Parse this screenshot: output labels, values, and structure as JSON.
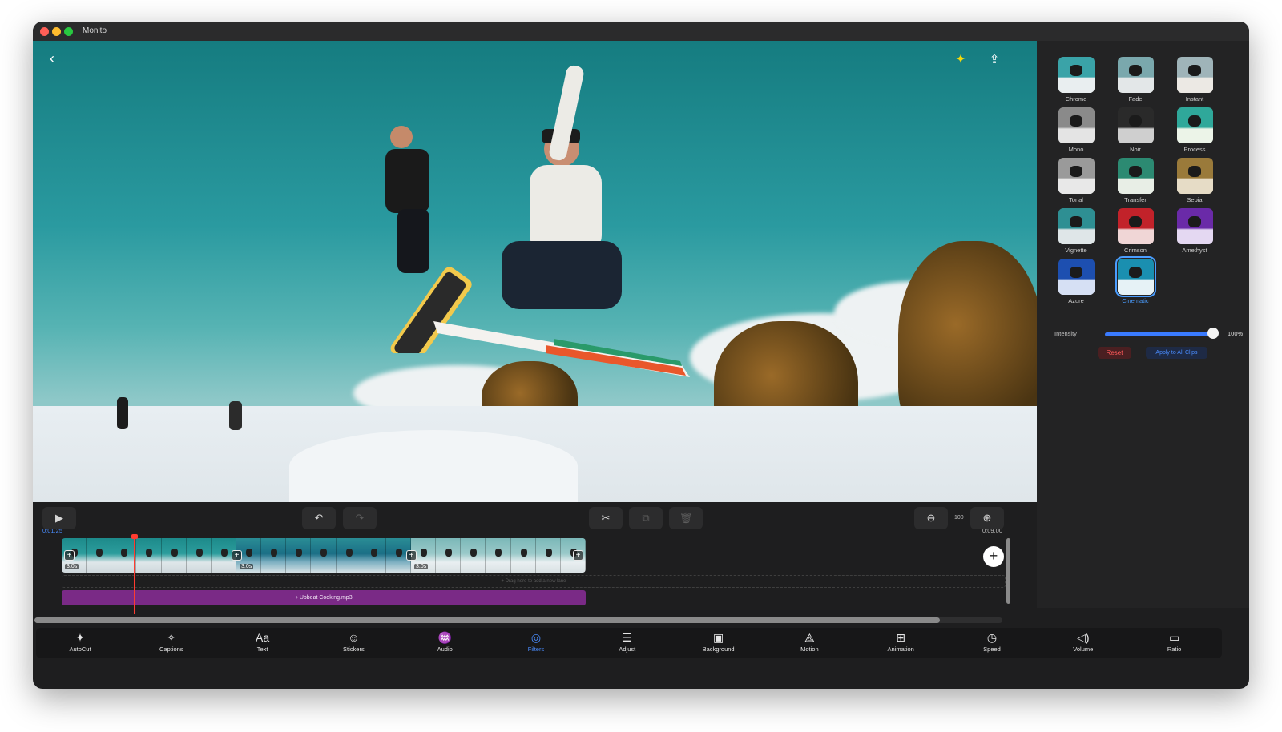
{
  "window": {
    "title": "Monito"
  },
  "preview": {
    "back_icon": "chevron-left-icon",
    "magic_icon": "sparkles-icon",
    "share_icon": "share-icon",
    "accent": "#f5d90a"
  },
  "filters": {
    "items": [
      {
        "label": "Chrome",
        "tint": "#3aa3a8",
        "snow": "#e9eef0"
      },
      {
        "label": "Fade",
        "tint": "#7aa8ad",
        "snow": "#e3e7e8"
      },
      {
        "label": "Instant",
        "tint": "#9fb4b9",
        "snow": "#ece9e4"
      },
      {
        "label": "Mono",
        "tint": "#8a8a8a",
        "snow": "#e4e4e4"
      },
      {
        "label": "Noir",
        "tint": "#2a2a2a",
        "snow": "#cfcfcf"
      },
      {
        "label": "Process",
        "tint": "#2fa89a",
        "snow": "#ecf4e8"
      },
      {
        "label": "Tonal",
        "tint": "#9a9a9a",
        "snow": "#e8e8e8"
      },
      {
        "label": "Transfer",
        "tint": "#2c8a72",
        "snow": "#e8eee6"
      },
      {
        "label": "Sepia",
        "tint": "#9a7a3a",
        "snow": "#e6dcc6"
      },
      {
        "label": "Vignette",
        "tint": "#2e8f93",
        "snow": "#dfe6e8"
      },
      {
        "label": "Crimson",
        "tint": "#c2222a",
        "snow": "#f0d6d6"
      },
      {
        "label": "Amethyst",
        "tint": "#6a2aa8",
        "snow": "#e4d8f2"
      },
      {
        "label": "Azure",
        "tint": "#1d4fb0",
        "snow": "#d6e0f4"
      },
      {
        "label": "Cinematic",
        "tint": "#1a8fb0",
        "snow": "#e6f2f6",
        "selected": true
      }
    ],
    "intensity_label": "Intensity",
    "intensity_value": "100%",
    "intensity_fraction": 1.0,
    "reset_label": "Reset",
    "apply_all_label": "Apply to All Clips"
  },
  "toolbar": {
    "play_icon": "play-icon",
    "undo_icon": "undo-icon",
    "redo_icon": "redo-icon",
    "cut_icon": "scissors-icon",
    "duplicate_icon": "duplicate-icon",
    "delete_icon": "trash-icon",
    "zoom_out_icon": "zoom-out-icon",
    "zoom_in_icon": "zoom-in-icon",
    "zoom_value": "100",
    "current_time": "0:01.25",
    "total_time": "0:09.00"
  },
  "timeline": {
    "clips": [
      {
        "duration": "3.0s"
      },
      {
        "duration": "3.0s"
      },
      {
        "duration": "3.0s"
      }
    ],
    "new_lane_hint": "+ Drag here to add a new lane",
    "audio_track": "♪ Upbeat Cooking.mp3",
    "playhead_color": "#ff3b30"
  },
  "tabs": [
    {
      "label": "AutoCut",
      "icon": "magic-wand-icon",
      "glyph": "✦"
    },
    {
      "label": "Captions",
      "icon": "sparkle-icon",
      "glyph": "✧"
    },
    {
      "label": "Text",
      "icon": "text-icon",
      "glyph": "Aa"
    },
    {
      "label": "Stickers",
      "icon": "smiley-icon",
      "glyph": "☺"
    },
    {
      "label": "Audio",
      "icon": "waveform-icon",
      "glyph": "♒"
    },
    {
      "label": "Filters",
      "icon": "filters-icon",
      "glyph": "◎",
      "active": true
    },
    {
      "label": "Adjust",
      "icon": "sliders-icon",
      "glyph": "☰"
    },
    {
      "label": "Background",
      "icon": "background-icon",
      "glyph": "▣"
    },
    {
      "label": "Motion",
      "icon": "motion-icon",
      "glyph": "⟁"
    },
    {
      "label": "Animation",
      "icon": "animation-icon",
      "glyph": "⊞"
    },
    {
      "label": "Speed",
      "icon": "speed-icon",
      "glyph": "◷"
    },
    {
      "label": "Volume",
      "icon": "volume-icon",
      "glyph": "◁)"
    },
    {
      "label": "Ratio",
      "icon": "ratio-icon",
      "glyph": "▭"
    }
  ],
  "colors": {
    "accent_blue": "#4a8dff",
    "danger_red": "#ff5a5a",
    "audio_purple": "#7a2a86"
  }
}
